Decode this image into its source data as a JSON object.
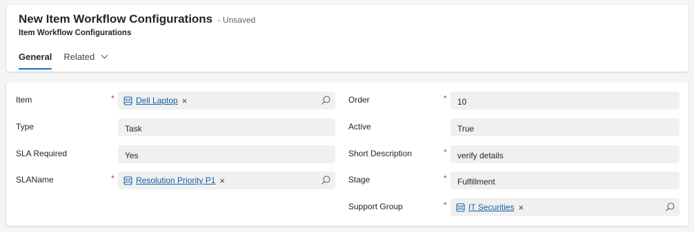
{
  "header": {
    "title": "New Item Workflow Configurations",
    "status": "- Unsaved",
    "subtitle": "Item Workflow Configurations",
    "tabs": [
      {
        "label": "General",
        "active": true
      },
      {
        "label": "Related",
        "active": false,
        "has_dropdown": true
      }
    ]
  },
  "form": {
    "left": [
      {
        "label": "Item",
        "required": true,
        "type": "lookup",
        "value": "Dell Laptop"
      },
      {
        "label": "Type",
        "required": false,
        "type": "text",
        "value": "Task"
      },
      {
        "label": "SLA Required",
        "required": false,
        "type": "text",
        "value": "Yes"
      },
      {
        "label": "SLAName",
        "required": true,
        "type": "lookup",
        "value": "Resolution Priority P1"
      }
    ],
    "right": [
      {
        "label": "Order",
        "required": true,
        "type": "text",
        "value": "10"
      },
      {
        "label": "Active",
        "required": false,
        "type": "text",
        "value": "True"
      },
      {
        "label": "Short Description",
        "required": true,
        "type": "text",
        "value": "verify details"
      },
      {
        "label": "Stage",
        "required": true,
        "type": "text",
        "value": "Fulfillment"
      },
      {
        "label": "Support Group",
        "required": true,
        "type": "lookup",
        "value": "IT Securities"
      }
    ],
    "required_marker": "*",
    "remove_glyph": "×"
  },
  "icons": {
    "entity": "lookup-entity-icon",
    "search": "search-icon",
    "dropdown": "chevron-down-icon",
    "remove": "close-icon"
  },
  "colors": {
    "accent": "#0f6cbd",
    "link": "#115ea3",
    "required": "#c4314b",
    "field_bg": "#f0f0f0"
  }
}
